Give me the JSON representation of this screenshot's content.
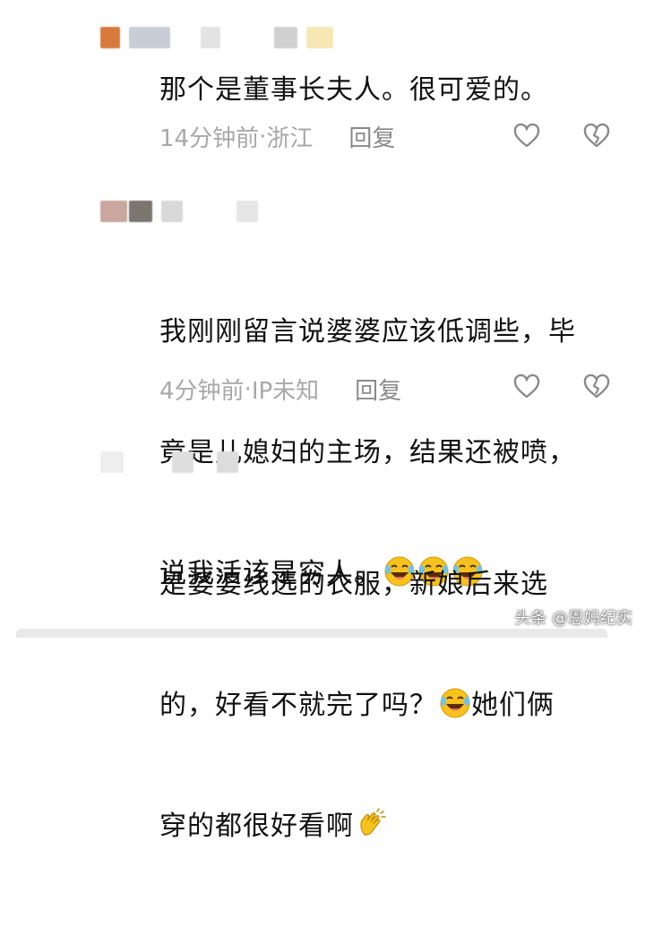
{
  "comments": [
    {
      "text": "那个是董事长夫人。很可爱的。",
      "time": "14分钟前",
      "location": "浙江",
      "reply_label": "回复"
    },
    {
      "text_lines": [
        "我刚刚留言说婆婆应该低调些，毕",
        "竟是儿媳妇的主场，结果还被喷，",
        "说我活该是穷人。"
      ],
      "time": "4分钟前",
      "location": "IP未知",
      "reply_label": "回复"
    },
    {
      "text_lines": [
        "是婆婆线选的衣服，新娘后来选",
        "的，好看不就完了吗？",
        "她们俩",
        "穿的都很好看啊"
      ]
    }
  ],
  "meta_separator": " · ",
  "watermark": "头条 @恩妈纪实",
  "icons": {
    "like": "heart-outline-icon",
    "dislike": "broken-heart-icon",
    "laugh_emoji": "laughing-crying-emoji",
    "clap_emoji": "clapping-hands-emoji"
  },
  "colors": {
    "text": "#111111",
    "meta": "#a8a8a8",
    "emoji_yellow": "#f7c21b"
  }
}
